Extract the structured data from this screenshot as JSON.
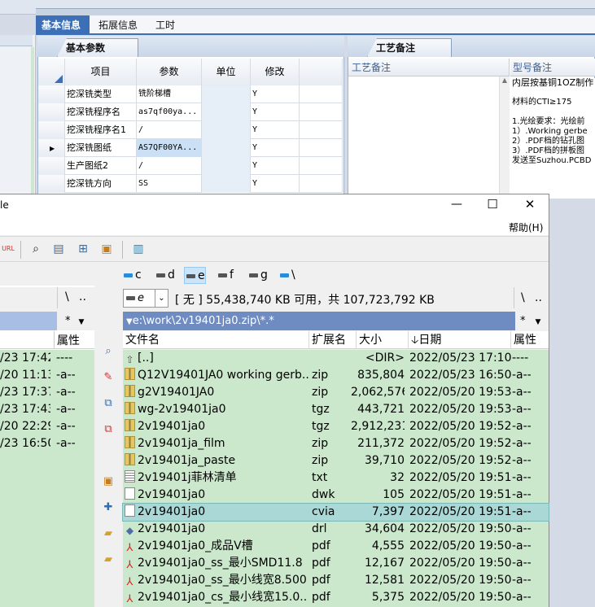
{
  "bg_app": {
    "tabs": [
      "基本信息",
      "拓展信息",
      "工时"
    ],
    "pane1_tab": "基本参数",
    "pane2_tab": "工艺备注",
    "grid_headers": [
      "项目",
      "参数",
      "单位",
      "修改"
    ],
    "grid_rows": [
      {
        "item": "挖深铣类型",
        "param": "铣阶梯槽",
        "unit": "",
        "modify": "Y"
      },
      {
        "item": "挖深铣程序名",
        "param": "as7qf00ya...",
        "unit": "",
        "modify": "Y"
      },
      {
        "item": "挖深铣程序名1",
        "param": "/",
        "unit": "",
        "modify": "Y"
      },
      {
        "item": "挖深铣图纸",
        "param": "AS7QF00YA...",
        "unit": "",
        "modify": "Y"
      },
      {
        "item": "生产图纸2",
        "param": "/",
        "unit": "",
        "modify": "Y"
      },
      {
        "item": "挖深铣方向",
        "param": "SS",
        "unit": "",
        "modify": "Y"
      }
    ],
    "remark_headers": [
      "工艺备注",
      "型号备注"
    ],
    "remark_lines": [
      "内层按基铜1OZ制作",
      "",
      "材料的CTI≥175",
      "",
      "1.光绘要求：光绘前",
      "1）.Working gerbe",
      "2）.PDF档的钻孔图",
      "3）.PDF档的拼板图",
      "发送至Suzhou.PCBD"
    ]
  },
  "window": {
    "title_fragment": "le",
    "minimize": "—",
    "maximize": "☐",
    "close": "✕",
    "menu_help": "帮助(H)"
  },
  "drives": [
    "c",
    "d",
    "e",
    "f",
    "g",
    "\\"
  ],
  "left_panel": {
    "nav_back": "\\",
    "nav_up": "..",
    "filter": "*",
    "attr_header": "属性",
    "rows": [
      {
        "date": "/23 17:42",
        "attr": "----"
      },
      {
        "date": "/20 11:13",
        "attr": "-a--"
      },
      {
        "date": "/23 17:37",
        "attr": "-a--"
      },
      {
        "date": "/23 17:43",
        "attr": "-a--"
      },
      {
        "date": "/20 22:29",
        "attr": "-a--"
      },
      {
        "date": "/23 16:50",
        "attr": "-a--"
      }
    ]
  },
  "right_panel": {
    "drive_select": "e",
    "drive_info": "[ 无 ]  55,438,740 KB 可用，共 107,723,792 KB",
    "nav_back": "\\",
    "nav_up": "..",
    "path": "e:\\work\\2v19401ja0.zip\\*.*",
    "filter": "*",
    "headers": {
      "name": "文件名",
      "ext": "扩展名",
      "size": "大小",
      "date": "日期",
      "attr": "属性"
    },
    "sort_arrow": "🡣",
    "files": [
      {
        "icon": "up",
        "name": "[..]",
        "ext": "",
        "size": "<DIR>",
        "date": "2022/05/23 17:10",
        "attr": "----"
      },
      {
        "icon": "zip",
        "name": "Q12V19401JA0 working gerb..",
        "ext": "zip",
        "size": "835,804",
        "date": "2022/05/23 16:50",
        "attr": "-a--"
      },
      {
        "icon": "zip",
        "name": "g2V19401JA0",
        "ext": "zip",
        "size": "2,062,576",
        "date": "2022/05/20 19:53",
        "attr": "-a--"
      },
      {
        "icon": "zip",
        "name": "wg-2v19401ja0",
        "ext": "tgz",
        "size": "443,721",
        "date": "2022/05/20 19:53",
        "attr": "-a--"
      },
      {
        "icon": "zip",
        "name": "2v19401ja0",
        "ext": "tgz",
        "size": "2,912,231",
        "date": "2022/05/20 19:52",
        "attr": "-a--"
      },
      {
        "icon": "zip",
        "name": "2v19401ja_film",
        "ext": "zip",
        "size": "211,372",
        "date": "2022/05/20 19:52",
        "attr": "-a--"
      },
      {
        "icon": "zip",
        "name": "2v19401ja_paste",
        "ext": "zip",
        "size": "39,710",
        "date": "2022/05/20 19:52",
        "attr": "-a--"
      },
      {
        "icon": "txt",
        "name": "2v19401j菲林清单",
        "ext": "txt",
        "size": "32",
        "date": "2022/05/20 19:51",
        "attr": "-a--"
      },
      {
        "icon": "doc",
        "name": "2v19401ja0",
        "ext": "dwk",
        "size": "105",
        "date": "2022/05/20 19:51",
        "attr": "-a--"
      },
      {
        "icon": "doc",
        "name": "2v19401ja0",
        "ext": "cvia",
        "size": "7,397",
        "date": "2022/05/20 19:51",
        "attr": "-a--",
        "selected": true
      },
      {
        "icon": "drl",
        "name": "2v19401ja0",
        "ext": "drl",
        "size": "34,604",
        "date": "2022/05/20 19:50",
        "attr": "-a--"
      },
      {
        "icon": "pdf",
        "name": "2v19401ja0_成品V槽",
        "ext": "pdf",
        "size": "4,555",
        "date": "2022/05/20 19:50",
        "attr": "-a--"
      },
      {
        "icon": "pdf",
        "name": "2v19401ja0_ss_最小SMD11.8",
        "ext": "pdf",
        "size": "12,167",
        "date": "2022/05/20 19:50",
        "attr": "-a--"
      },
      {
        "icon": "pdf",
        "name": "2v19401ja0_ss_最小线宽8.500",
        "ext": "pdf",
        "size": "12,581",
        "date": "2022/05/20 19:50",
        "attr": "-a--"
      },
      {
        "icon": "pdf",
        "name": "2v19401ja0_cs_最小线宽15.0..",
        "ext": "pdf",
        "size": "5,375",
        "date": "2022/05/20 19:50",
        "attr": "-a--"
      }
    ]
  },
  "colors": {
    "list_bg": "#cce8cc",
    "selected": "#a9d8d6",
    "path_bar": "#6f8cc2",
    "tab_active": "#3d6fb6"
  }
}
